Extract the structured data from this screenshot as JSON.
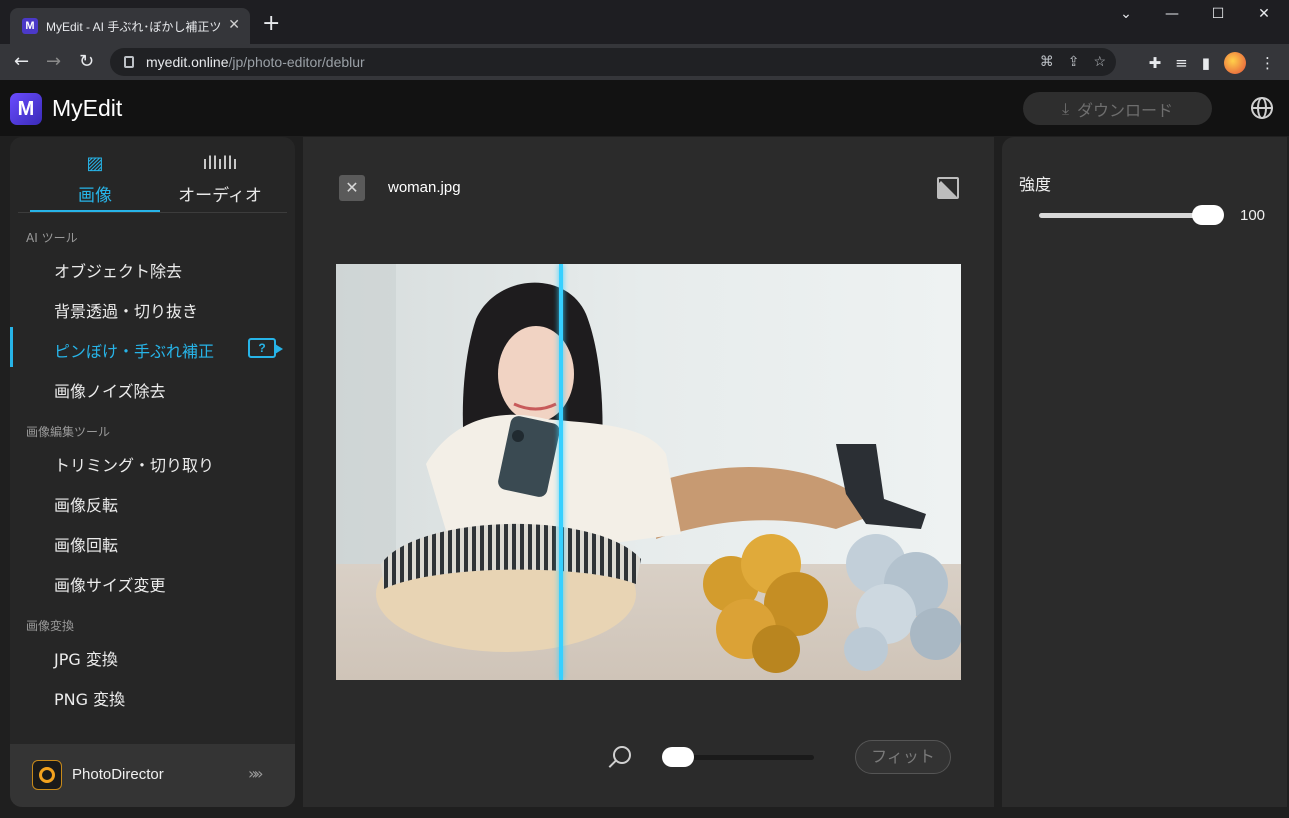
{
  "browser": {
    "tab_title": "MyEdit - AI 手ぶれ･ぼかし補正ツール",
    "tab_favicon": "M",
    "url_host": "myedit.online",
    "url_path": "/jp/photo-editor/deblur"
  },
  "header": {
    "logo_mark": "M",
    "logo_text": "MyEdit",
    "download_label": "ダウンロード"
  },
  "sidebar": {
    "tabs": [
      {
        "label": "画像",
        "icon": "image-icon",
        "active": true
      },
      {
        "label": "オーディオ",
        "icon": "waveform-icon",
        "active": false
      }
    ],
    "sections": [
      {
        "title": "AI ツール",
        "items": [
          "オブジェクト除去",
          "背景透過・切り抜き",
          "ピンぼけ・手ぶれ補正",
          "画像ノイズ除去"
        ]
      },
      {
        "title": "画像編集ツール",
        "items": [
          "トリミング・切り取り",
          "画像反転",
          "画像回転",
          "画像サイズ変更"
        ]
      },
      {
        "title": "画像変換",
        "items": [
          "JPG 変換",
          "PNG 変換"
        ]
      }
    ],
    "active_item": "ピンぼけ・手ぶれ補正",
    "promo": {
      "name": "PhotoDirector",
      "arrow": "»»"
    }
  },
  "editor": {
    "file_name": "woman.jpg",
    "zoom_level": 0,
    "fit_label": "フィット",
    "compare_split": 0.36
  },
  "settings": {
    "strength_label": "強度",
    "strength_value": "100",
    "strength_fraction": 1.0
  },
  "colors": {
    "accent": "#27b4e8",
    "split_line": "#36d0ff",
    "brand": "#4b39c8"
  }
}
